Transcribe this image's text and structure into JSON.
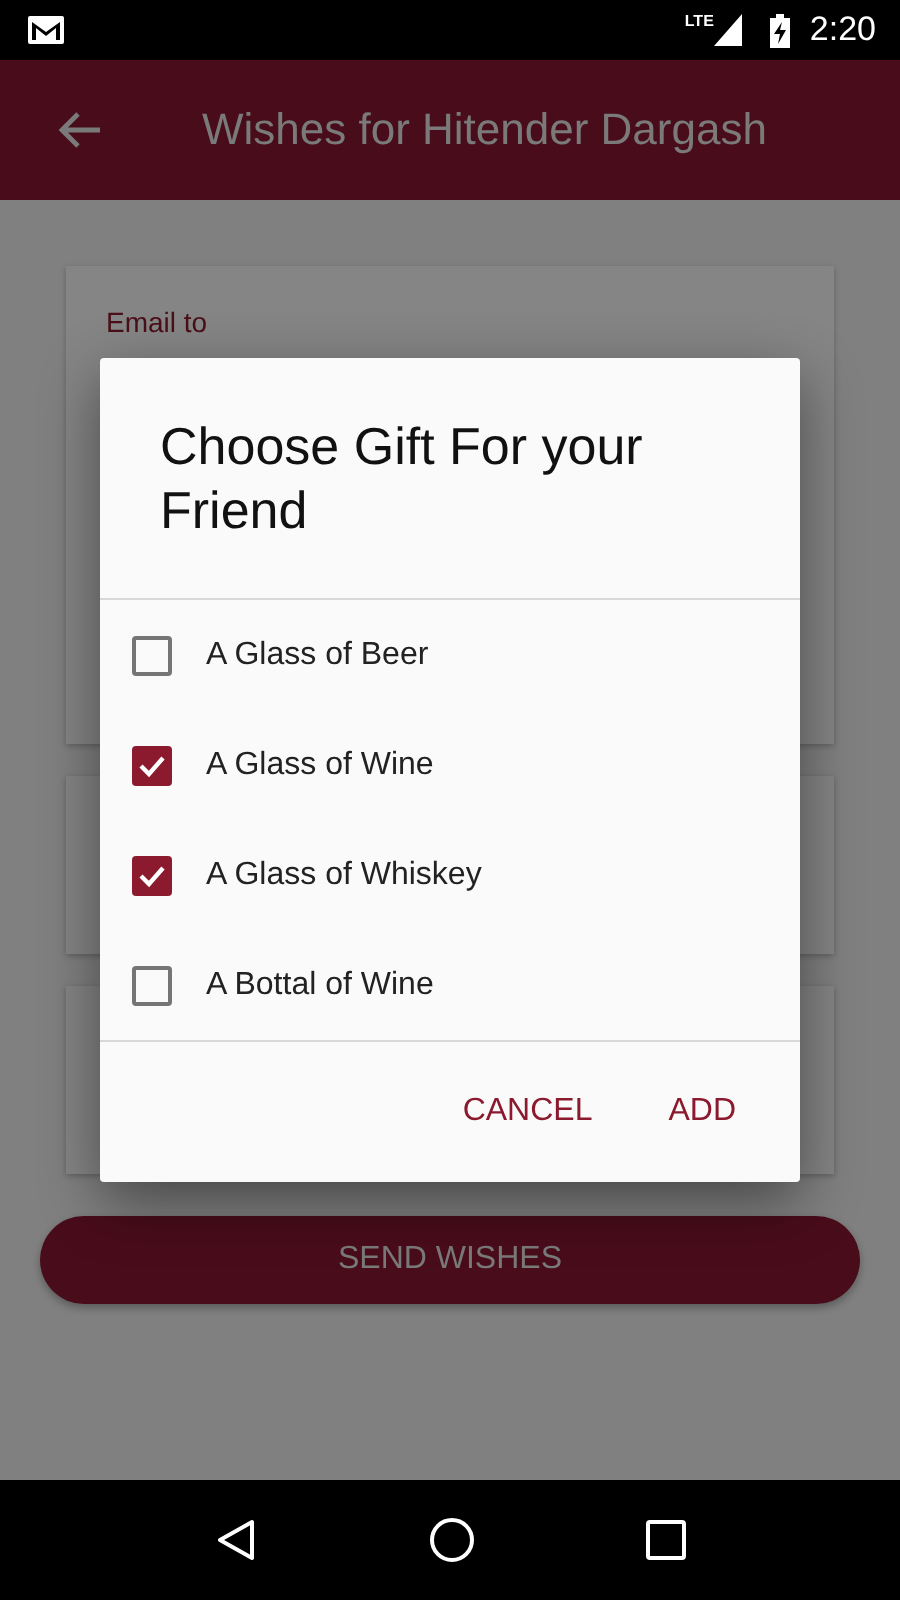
{
  "status_bar": {
    "network": "LTE",
    "time": "2:20"
  },
  "app_bar": {
    "title": "Wishes for Hitender Dargash"
  },
  "form": {
    "email_label": "Email to",
    "submit": "SEND WISHES"
  },
  "dialog": {
    "title": "Choose Gift For your Friend",
    "options": [
      {
        "label": "A Glass of Beer",
        "checked": false
      },
      {
        "label": "A Glass of Wine",
        "checked": true
      },
      {
        "label": "A Glass of Whiskey",
        "checked": true
      },
      {
        "label": "A Bottal of Wine",
        "checked": false
      }
    ],
    "buttons": [
      "CANCEL",
      "ADD"
    ]
  }
}
